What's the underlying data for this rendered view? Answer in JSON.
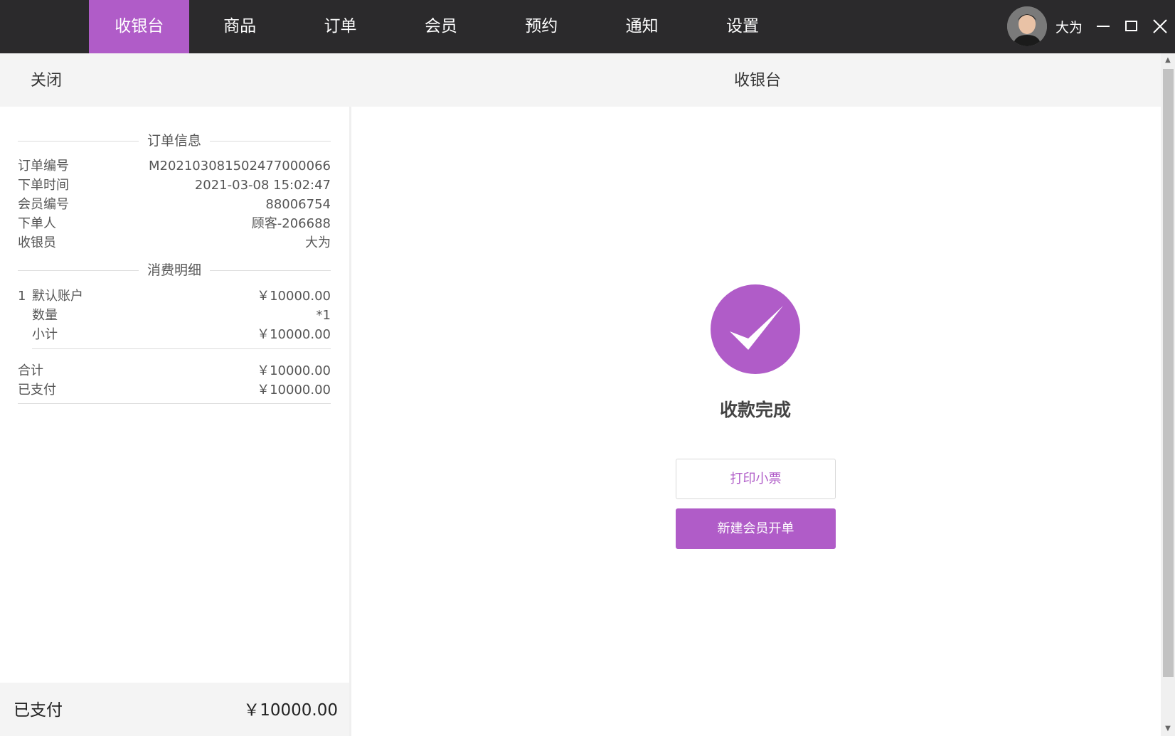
{
  "nav": {
    "items": [
      {
        "label": "收银台",
        "active": true
      },
      {
        "label": "商品",
        "active": false
      },
      {
        "label": "订单",
        "active": false
      },
      {
        "label": "会员",
        "active": false
      },
      {
        "label": "预约",
        "active": false
      },
      {
        "label": "通知",
        "active": false
      },
      {
        "label": "设置",
        "active": false
      }
    ],
    "user_name": "大为"
  },
  "header": {
    "close_label": "关闭",
    "title": "收银台"
  },
  "order_info": {
    "section_title": "订单信息",
    "rows": [
      {
        "label": "订单编号",
        "value": "M202103081502477000066"
      },
      {
        "label": "下单时间",
        "value": "2021-03-08 15:02:47"
      },
      {
        "label": "会员编号",
        "value": "88006754"
      },
      {
        "label": "下单人",
        "value": "顾客-206688"
      },
      {
        "label": "收银员",
        "value": "大为"
      }
    ]
  },
  "consumption": {
    "section_title": "消费明细",
    "items": [
      {
        "index": "1",
        "name": "默认账户",
        "price": "￥10000.00",
        "qty_label": "数量",
        "qty": "*1",
        "subtotal_label": "小计",
        "subtotal": "￥10000.00"
      }
    ],
    "total_label": "合计",
    "total": "￥10000.00",
    "paid_label": "已支付",
    "paid": "￥10000.00"
  },
  "footer": {
    "paid_label": "已支付",
    "paid_value": "￥10000.00"
  },
  "result": {
    "message": "收款完成",
    "print_button": "打印小票",
    "new_order_button": "新建会员开单"
  },
  "colors": {
    "accent": "#b05cc8",
    "topbar": "#2b2a2c"
  }
}
